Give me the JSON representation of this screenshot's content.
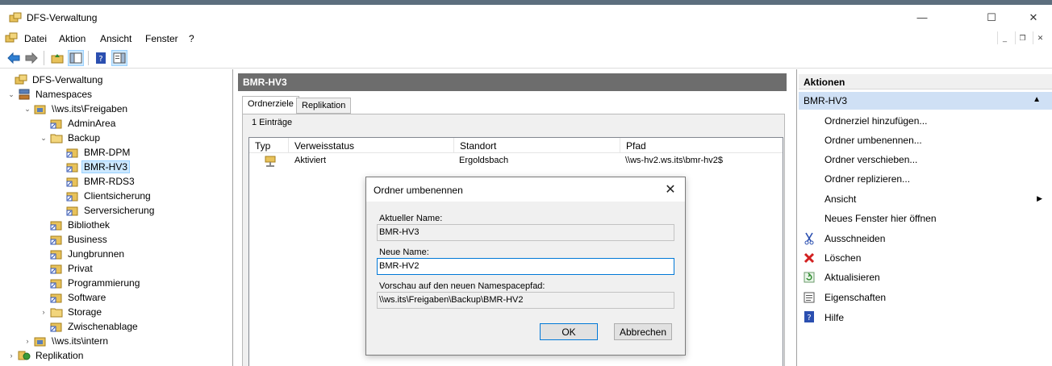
{
  "window": {
    "title": "DFS-Verwaltung",
    "minimize": "—",
    "maximize": "☐",
    "close": "✕"
  },
  "menu": [
    "Datei",
    "Aktion",
    "Ansicht",
    "Fenster",
    "?"
  ],
  "mdi": {
    "minimize": "_",
    "restore": "❐",
    "close": "✕"
  },
  "tree": {
    "root": "DFS-Verwaltung",
    "namespaces": "Namespaces",
    "freigaben": "\\\\ws.its\\Freigaben",
    "adminarea": "AdminArea",
    "backup": "Backup",
    "bmr_dpm": "BMR-DPM",
    "bmr_hv3": "BMR-HV3",
    "bmr_rds3": "BMR-RDS3",
    "clientsicherung": "Clientsicherung",
    "serversicherung": "Serversicherung",
    "bibliothek": "Bibliothek",
    "business": "Business",
    "jungbrunnen": "Jungbrunnen",
    "privat": "Privat",
    "programmierung": "Programmierung",
    "software": "Software",
    "storage": "Storage",
    "zwischenablage": "Zwischenablage",
    "intern": "\\\\ws.its\\intern",
    "replikation": "Replikation"
  },
  "center": {
    "header": "BMR-HV3",
    "tabs": [
      "Ordnerziele",
      "Replikation"
    ],
    "entries": "1 Einträge",
    "columns": [
      "Typ",
      "Verweisstatus",
      "Standort",
      "Pfad"
    ],
    "rows": [
      {
        "status": "Aktiviert",
        "standort": "Ergoldsbach",
        "pfad": "\\\\ws-hv2.ws.its\\bmr-hv2$"
      }
    ]
  },
  "dialog": {
    "title": "Ordner umbenennen",
    "current_label": "Aktueller Name:",
    "current_value": "BMR-HV3",
    "new_label": "Neue Name:",
    "new_value": "BMR-HV2",
    "preview_label": "Vorschau auf den neuen Namespacepfad:",
    "preview_value": "\\\\ws.its\\Freigaben\\Backup\\BMR-HV2",
    "ok": "OK",
    "cancel": "Abbrechen"
  },
  "actions": {
    "header": "Aktionen",
    "section": "BMR-HV3",
    "items": [
      "Ordnerziel hinzufügen...",
      "Ordner umbenennen...",
      "Ordner verschieben...",
      "Ordner replizieren...",
      "Ansicht",
      "Neues Fenster hier öffnen",
      "Ausschneiden",
      "Löschen",
      "Aktualisieren",
      "Eigenschaften",
      "Hilfe"
    ]
  },
  "colors": {
    "header_bg": "#6d6d6d",
    "section_bg": "#cfe0f5",
    "selection": "#cce8ff",
    "accent": "#0078d7"
  }
}
